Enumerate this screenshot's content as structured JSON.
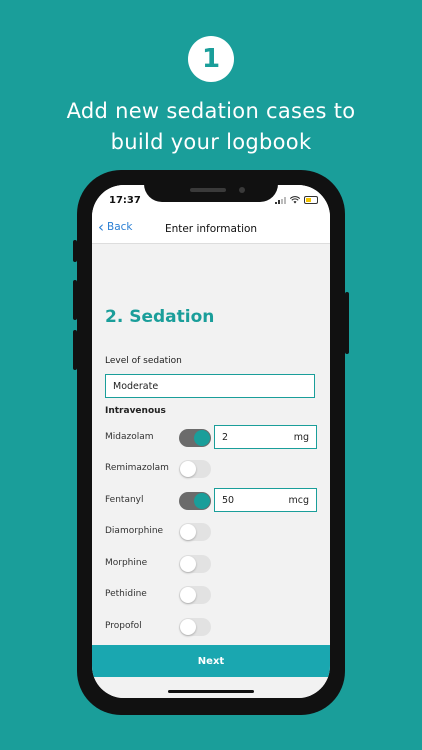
{
  "promo": {
    "step_number": "1",
    "headline_line1": "Add new sedation cases to",
    "headline_line2": "build your logbook"
  },
  "status_bar": {
    "time": "17:37"
  },
  "nav": {
    "back_label": "Back",
    "title": "Enter information"
  },
  "form": {
    "section_title": "2. Sedation",
    "level_label": "Level of sedation",
    "level_value": "Moderate",
    "intravenous_heading": "Intravenous",
    "drugs": [
      {
        "name": "Midazolam",
        "enabled": true,
        "dose": "2",
        "unit": "mg"
      },
      {
        "name": "Remimazolam",
        "enabled": false
      },
      {
        "name": "Fentanyl",
        "enabled": true,
        "dose": "50",
        "unit": "mcg"
      },
      {
        "name": "Diamorphine",
        "enabled": false
      },
      {
        "name": "Morphine",
        "enabled": false
      },
      {
        "name": "Pethidine",
        "enabled": false
      },
      {
        "name": "Propofol",
        "enabled": false
      }
    ]
  },
  "footer": {
    "next_label": "Next"
  },
  "colors": {
    "brand_teal": "#1a9e9a",
    "button_teal": "#1aa7b0",
    "link_blue": "#2a7fd4"
  }
}
